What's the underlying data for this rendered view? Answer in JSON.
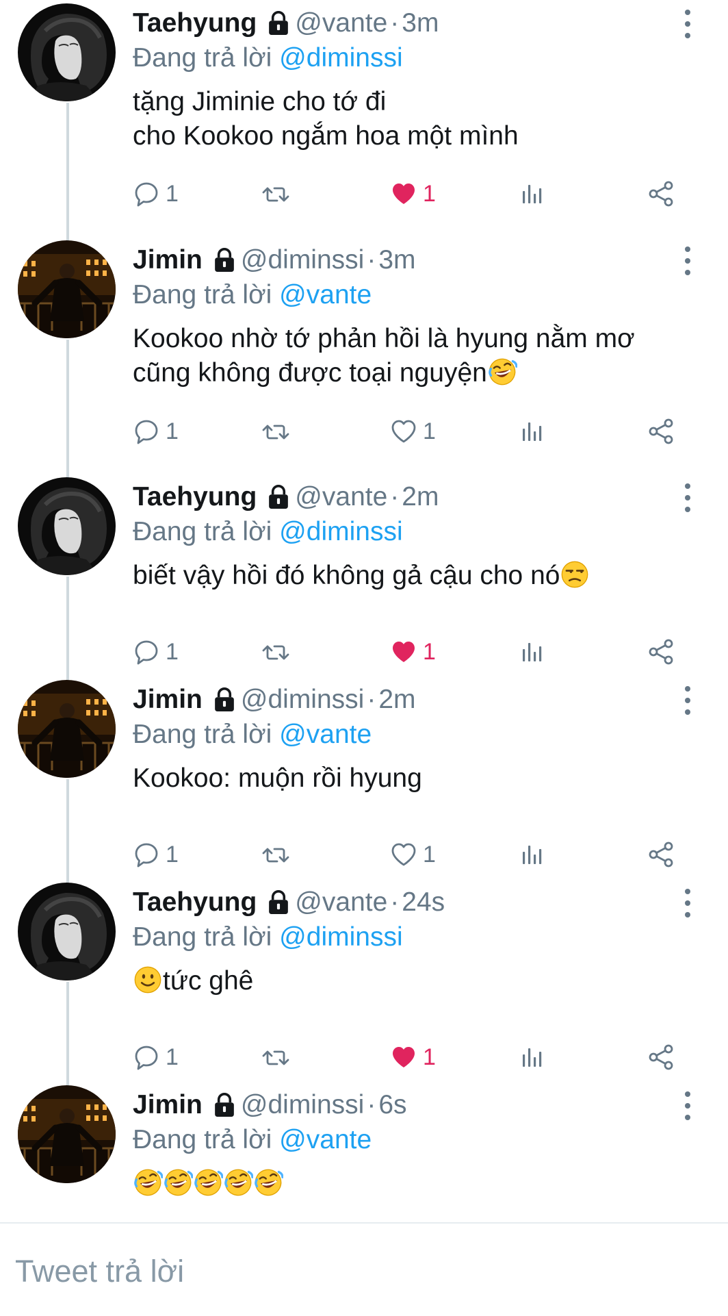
{
  "tweets": [
    {
      "author": {
        "name": "Taehyung",
        "handle": "@vante",
        "locked": true,
        "avatar": "taehyung-avatar"
      },
      "time": "3m",
      "reply_prefix": "Đang trả lời",
      "reply_to": "@diminssi",
      "text": "tặng Jiminie cho tớ đi\ncho Kookoo ngắm hoa một mình",
      "emoji_suffix": [],
      "stats": {
        "replies": "1",
        "retweets": "",
        "likes": "1",
        "liked": true
      }
    },
    {
      "author": {
        "name": "Jimin",
        "handle": "@diminssi",
        "locked": true,
        "avatar": "jimin-avatar"
      },
      "time": "3m",
      "reply_prefix": "Đang trả lời",
      "reply_to": "@vante",
      "text": "Kookoo nhờ tớ phản hồi là hyung nằm mơ\ncũng không được toại nguyện",
      "emoji_suffix": [
        "rofl"
      ],
      "stats": {
        "replies": "1",
        "retweets": "",
        "likes": "1",
        "liked": false
      }
    },
    {
      "author": {
        "name": "Taehyung",
        "handle": "@vante",
        "locked": true,
        "avatar": "taehyung-avatar"
      },
      "time": "2m",
      "reply_prefix": "Đang trả lời",
      "reply_to": "@diminssi",
      "text": "biết vậy hồi đó không gả cậu cho nó",
      "emoji_suffix": [
        "unamused"
      ],
      "stats": {
        "replies": "1",
        "retweets": "",
        "likes": "1",
        "liked": true
      }
    },
    {
      "author": {
        "name": "Jimin",
        "handle": "@diminssi",
        "locked": true,
        "avatar": "jimin-avatar"
      },
      "time": "2m",
      "reply_prefix": "Đang trả lời",
      "reply_to": "@vante",
      "text": "Kookoo: muộn rồi hyung",
      "emoji_suffix": [],
      "stats": {
        "replies": "1",
        "retweets": "",
        "likes": "1",
        "liked": false
      }
    },
    {
      "author": {
        "name": "Taehyung",
        "handle": "@vante",
        "locked": true,
        "avatar": "taehyung-avatar"
      },
      "time": "24s",
      "reply_prefix": "Đang trả lời",
      "reply_to": "@diminssi",
      "text": "tức ghê",
      "emoji_prefix": [
        "slight-smile"
      ],
      "emoji_suffix": [],
      "stats": {
        "replies": "1",
        "retweets": "",
        "likes": "1",
        "liked": true
      }
    },
    {
      "author": {
        "name": "Jimin",
        "handle": "@diminssi",
        "locked": true,
        "avatar": "jimin-avatar"
      },
      "time": "6s",
      "reply_prefix": "Đang trả lời",
      "reply_to": "@vante",
      "text": "",
      "emoji_suffix": [
        "rofl",
        "rofl",
        "rofl",
        "rofl",
        "rofl"
      ],
      "stats": null
    }
  ],
  "reply_box": {
    "placeholder": "Tweet trả lời"
  },
  "colors": {
    "accent": "#1da1f2",
    "like": "#e0245e",
    "muted": "#657786",
    "thread_line": "#cfd9de"
  },
  "icons": [
    "lock-icon",
    "more-icon",
    "reply-icon",
    "retweet-icon",
    "heart-icon",
    "analytics-icon",
    "share-icon"
  ]
}
